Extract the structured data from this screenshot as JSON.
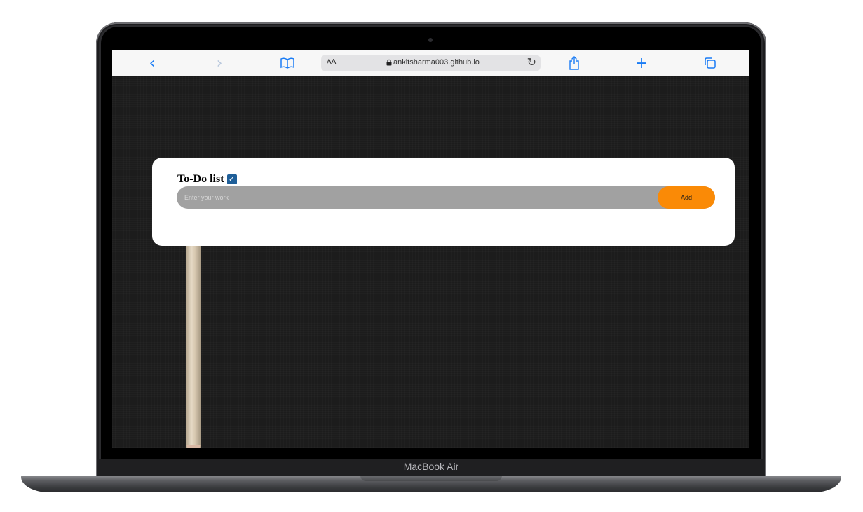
{
  "browser": {
    "reader_label": "AA",
    "url": "ankitsharma003.github.io"
  },
  "todo": {
    "title": "To-Do list",
    "input_placeholder": "Enter your work",
    "add_label": "Add"
  },
  "device": {
    "brand": "MacBook Air"
  },
  "colors": {
    "accent": "#1a7cf5",
    "add_button": "#fa8a06",
    "input_bg": "#a1a1a1",
    "checkbox": "#1f5f99"
  }
}
